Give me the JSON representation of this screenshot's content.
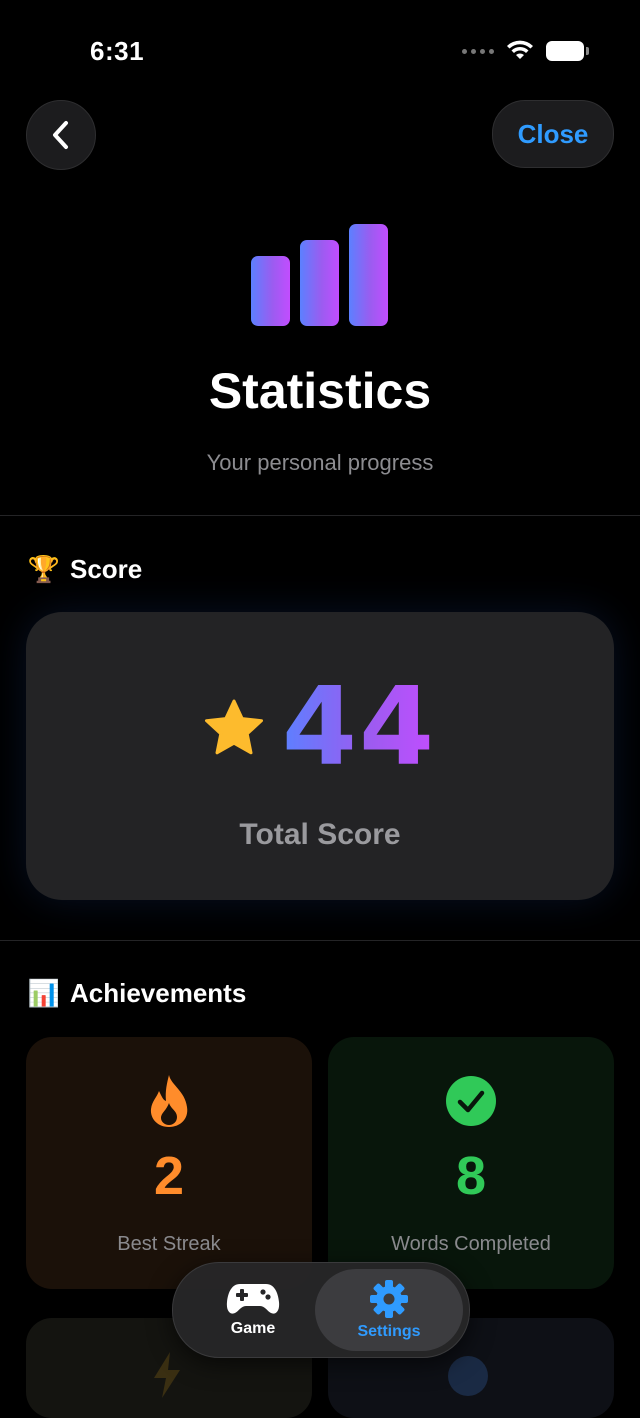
{
  "status_bar": {
    "time": "6:31"
  },
  "nav": {
    "close_label": "Close"
  },
  "header": {
    "title": "Statistics",
    "subtitle": "Your personal progress"
  },
  "score_section": {
    "title": "Score",
    "emoji": "🏆",
    "total_score": "44",
    "total_label": "Total Score"
  },
  "achievements_section": {
    "title": "Achievements",
    "emoji": "📊",
    "items": [
      {
        "value": "2",
        "label": "Best Streak",
        "icon": "flame-icon",
        "color": "#ff8c2b"
      },
      {
        "value": "8",
        "label": "Words Completed",
        "icon": "checkmark-circle-icon",
        "color": "#30c958"
      }
    ]
  },
  "tabbar": {
    "tabs": [
      {
        "label": "Game",
        "icon": "gamepad-icon"
      },
      {
        "label": "Settings",
        "icon": "gear-icon",
        "selected": true
      }
    ]
  },
  "colors": {
    "accent": "#2f9bff",
    "score_gradient_start": "#5c80ff",
    "score_gradient_end": "#c24dff",
    "star": "#fdbb2d"
  }
}
